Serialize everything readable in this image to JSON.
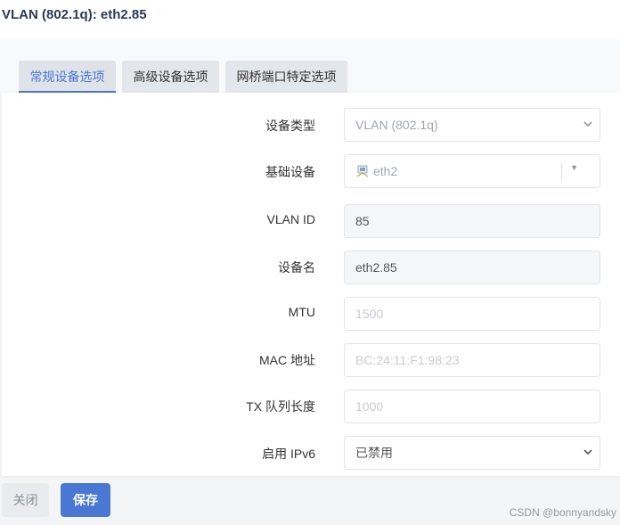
{
  "header": {
    "title": "VLAN (802.1q): eth2.85"
  },
  "tabs": [
    {
      "label": "常规设备选项",
      "active": true
    },
    {
      "label": "高级设备选项",
      "active": false
    },
    {
      "label": "网桥端口特定选项",
      "active": false
    }
  ],
  "form": {
    "device_type": {
      "label": "设备类型",
      "value": "VLAN (802.1q)"
    },
    "base_device": {
      "label": "基础设备",
      "value": "eth2"
    },
    "vlan_id": {
      "label": "VLAN ID",
      "value": "85"
    },
    "device_name": {
      "label": "设备名",
      "value": "eth2.85"
    },
    "mtu": {
      "label": "MTU",
      "placeholder": "1500"
    },
    "mac": {
      "label": "MAC 地址",
      "placeholder": "BC:24:11:F1:98:23"
    },
    "tx_queue": {
      "label": "TX 队列长度",
      "placeholder": "1000"
    },
    "ipv6": {
      "label": "启用 IPv6",
      "value": "已禁用"
    }
  },
  "footer": {
    "close_label": "关闭",
    "save_label": "保存"
  },
  "watermark": "CSDN @bonnyandsky",
  "colors": {
    "accent": "#4a77d4",
    "tab_bg": "#e3e6ea"
  }
}
